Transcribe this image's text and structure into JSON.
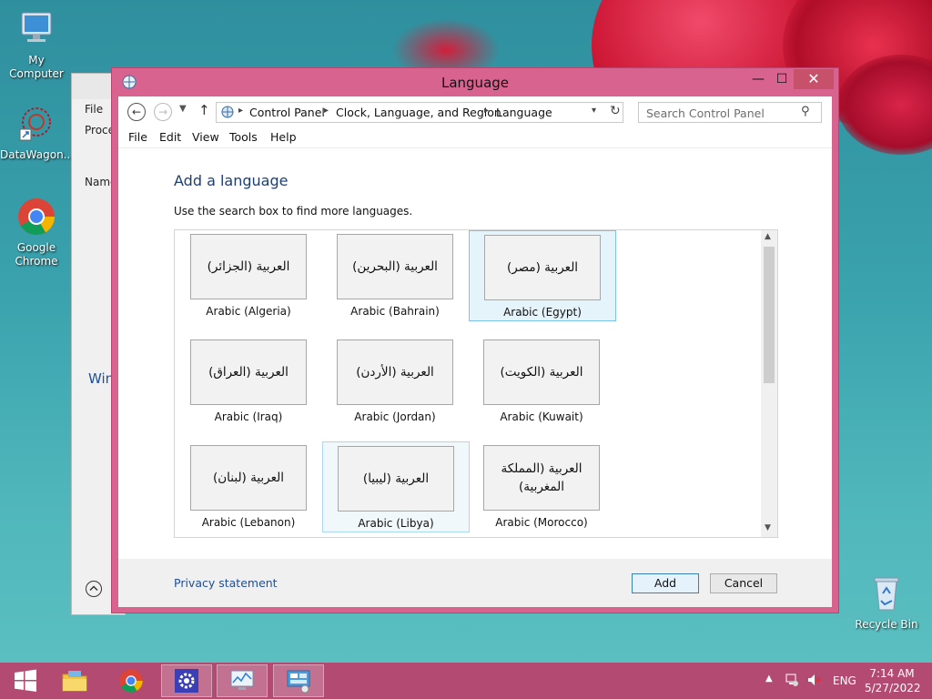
{
  "desktop": {
    "icons": [
      {
        "label": "My Computer"
      },
      {
        "label": "DataWagon..."
      },
      {
        "label": "Google Chrome"
      },
      {
        "label": "Recycle Bin"
      }
    ]
  },
  "background_window": {
    "menu_file": "File",
    "tab": "Proce",
    "column": "Name",
    "group": "Win"
  },
  "window": {
    "title": "Language",
    "controls": {
      "minimize": "—",
      "maximize": "☐",
      "close": "✕"
    },
    "breadcrumbs": [
      "Control Panel",
      "Clock, Language, and Region",
      "Language"
    ],
    "search_placeholder": "Search Control Panel",
    "menu": [
      "File",
      "Edit",
      "View",
      "Tools",
      "Help"
    ]
  },
  "page": {
    "title": "Add a language",
    "hint": "Use the search box to find more languages.",
    "languages": [
      {
        "native": "العربية (الجزائر)",
        "label": "Arabic (Algeria)",
        "state": "normal"
      },
      {
        "native": "العربية (البحرين)",
        "label": "Arabic (Bahrain)",
        "state": "normal"
      },
      {
        "native": "العربية (مصر)",
        "label": "Arabic (Egypt)",
        "state": "selected"
      },
      {
        "native": "العربية (العراق)",
        "label": "Arabic (Iraq)",
        "state": "normal"
      },
      {
        "native": "العربية (الأردن)",
        "label": "Arabic (Jordan)",
        "state": "normal"
      },
      {
        "native": "العربية (الكويت)",
        "label": "Arabic (Kuwait)",
        "state": "normal"
      },
      {
        "native": "العربية (لبنان)",
        "label": "Arabic (Lebanon)",
        "state": "normal"
      },
      {
        "native": "العربية (ليبيا)",
        "label": "Arabic (Libya)",
        "state": "hover"
      },
      {
        "native": "العربية (المملكة المغربية)",
        "label": "Arabic (Morocco)",
        "state": "normal"
      }
    ]
  },
  "footer": {
    "privacy": "Privacy statement",
    "add": "Add",
    "cancel": "Cancel"
  },
  "taskbar": {
    "language": "ENG",
    "time": "7:14 AM",
    "date": "5/27/2022"
  },
  "colors": {
    "window_frame": "#d8638e",
    "taskbar": "#b34a72",
    "title_text": "#1e3f73",
    "link": "#1e4f9a",
    "selected_bg": "#e5f3fb",
    "selected_border": "#7dc2e8"
  }
}
